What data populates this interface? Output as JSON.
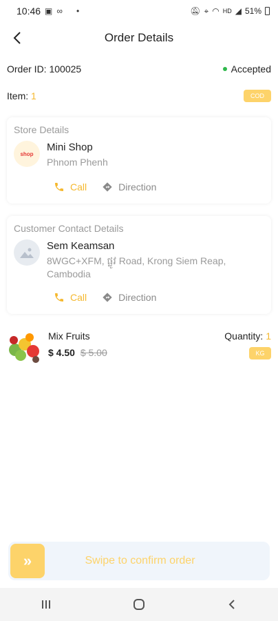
{
  "status_bar": {
    "time": "10:46",
    "left_icons": [
      "image-icon",
      "infinity-icon",
      "dot-icon"
    ],
    "right_icons": [
      "mute-icon",
      "location-icon",
      "wifi-icon",
      "signal-icon"
    ],
    "network": "HD",
    "battery": "51%"
  },
  "header": {
    "title": "Order Details"
  },
  "order": {
    "id_label": "Order ID:",
    "id_value": "100025",
    "status": "Accepted",
    "status_color": "#2eb84b",
    "item_label": "Item:",
    "item_count": "1",
    "payment_badge": "COD"
  },
  "store": {
    "section_title": "Store Details",
    "logo_text": "shop",
    "name": "Mini Shop",
    "location": "Phnom Phenh",
    "call_label": "Call",
    "direction_label": "Direction"
  },
  "customer": {
    "section_title": "Customer Contact Details",
    "name": "Sem Keamsan",
    "address": "8WGC+XFM, ផ្លូវ Road, Krong Siem Reap, Cambodia",
    "call_label": "Call",
    "direction_label": "Direction"
  },
  "product": {
    "name": "Mix Fruits",
    "price": "$ 4.50",
    "old_price": "$ 5.00",
    "quantity_label": "Quantity:",
    "quantity_value": "1",
    "unit_badge": "KG"
  },
  "swipe": {
    "label": "Swipe to confirm order",
    "handle_icon": "»"
  },
  "colors": {
    "accent": "#fdd36a",
    "accent_text": "#f5b82e",
    "success": "#2eb84b"
  }
}
